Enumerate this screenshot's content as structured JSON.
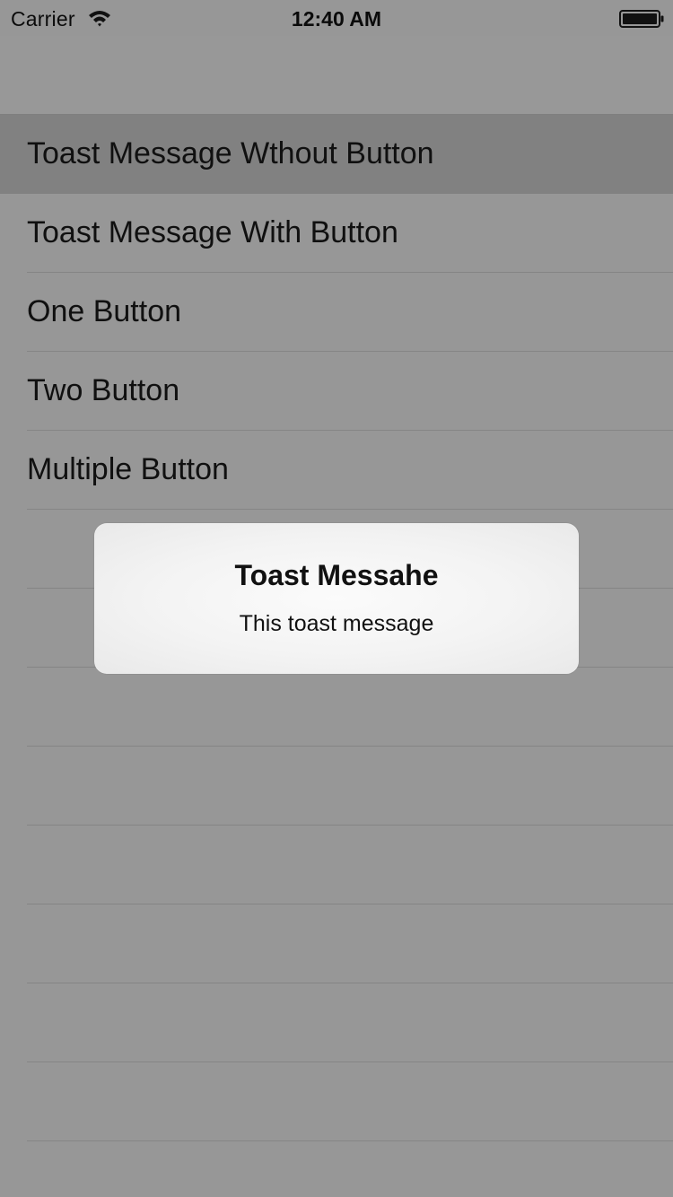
{
  "status_bar": {
    "carrier": "Carrier",
    "time": "12:40 AM",
    "wifi_icon": "wifi-icon",
    "battery_icon": "battery-icon"
  },
  "table": {
    "rows": [
      {
        "label": "Toast Message Wthout Button",
        "selected": true
      },
      {
        "label": "Toast Message With Button"
      },
      {
        "label": "One Button"
      },
      {
        "label": "Two Button"
      },
      {
        "label": "Multiple Button"
      },
      {
        "label": ""
      },
      {
        "label": ""
      },
      {
        "label": ""
      },
      {
        "label": ""
      },
      {
        "label": ""
      },
      {
        "label": ""
      },
      {
        "label": ""
      },
      {
        "label": ""
      }
    ]
  },
  "toast": {
    "title": "Toast Messahe",
    "message": "This toast message"
  },
  "colors": {
    "dimmed_background": "#979797",
    "selected_row": "#818181",
    "toast_background": "#f4f4f4"
  }
}
